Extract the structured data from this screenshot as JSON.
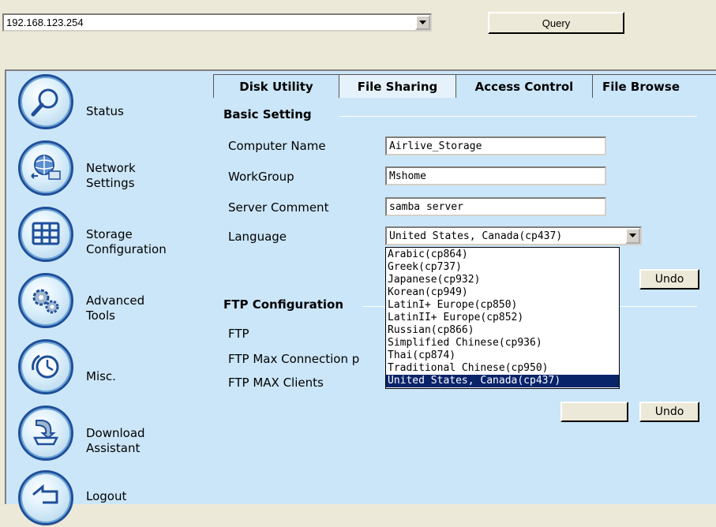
{
  "address_bar": {
    "value": "192.168.123.254",
    "query_label": "Query"
  },
  "sidebar": {
    "items": [
      {
        "line1": "Status",
        "line2": "",
        "icon": "magnifier-icon"
      },
      {
        "line1": "Network",
        "line2": "Settings",
        "icon": "network-icon"
      },
      {
        "line1": "Storage",
        "line2": "Configuration",
        "icon": "storage-grid-icon"
      },
      {
        "line1": "Advanced",
        "line2": "Tools",
        "icon": "gears-icon"
      },
      {
        "line1": "Misc.",
        "line2": "",
        "icon": "clock-icon"
      },
      {
        "line1": "Download",
        "line2": "Assistant",
        "icon": "download-tray-icon"
      },
      {
        "line1": "Logout",
        "line2": "",
        "icon": "back-arrow-icon"
      }
    ]
  },
  "tabs": [
    {
      "label": "Disk Utility",
      "active": false
    },
    {
      "label": "File Sharing",
      "active": true
    },
    {
      "label": "Access Control",
      "active": false
    },
    {
      "label": "File Browse",
      "active": false
    }
  ],
  "basic_setting": {
    "title": "Basic Setting",
    "computer_name_label": "Computer Name",
    "computer_name_value": "Airlive_Storage",
    "workgroup_label": "WorkGroup",
    "workgroup_value": "Mshome",
    "server_comment_label": "Server Comment",
    "server_comment_value": "samba server",
    "language_label": "Language",
    "language_value": "United States, Canada(cp437)",
    "undo_label": "Undo"
  },
  "language_options": [
    "Arabic(cp864)",
    "Greek(cp737)",
    "Japanese(cp932)",
    "Korean(cp949)",
    "LatinI+ Europe(cp850)",
    "LatinII+ Europe(cp852)",
    "Russian(cp866)",
    "Simplified Chinese(cp936)",
    "Thai(cp874)",
    "Traditional Chinese(cp950)",
    "United States, Canada(cp437)"
  ],
  "ftp_config": {
    "title": "FTP Configuration",
    "ftp_label": "FTP",
    "max_conn_label": "FTP Max Connection p",
    "max_clients_label": "FTP MAX Clients",
    "undo_label": "Undo"
  },
  "colors": {
    "panel_bg": "#cbe6f8",
    "selection": "#0a246a",
    "icon_ring": "#1f4f9a"
  }
}
